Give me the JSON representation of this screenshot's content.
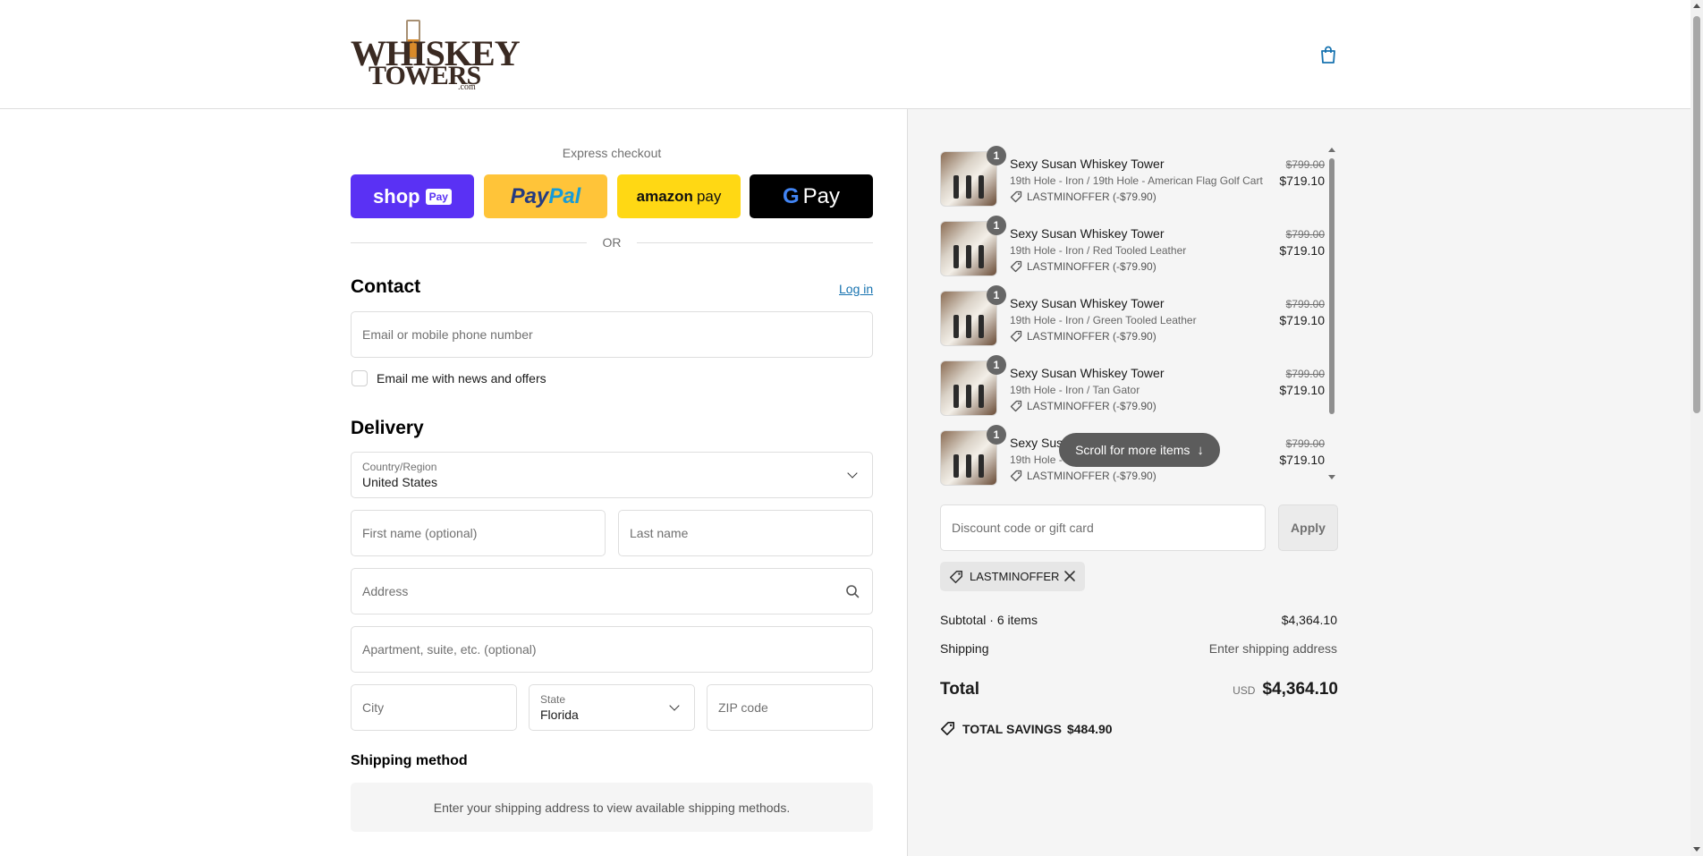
{
  "header": {
    "logo_top": "WHISKEY",
    "logo_bottom": "TOWERS",
    "logo_com": ".com",
    "cart_icon": "shopping-bag-icon"
  },
  "express": {
    "title": "Express checkout",
    "shop_label": "shop",
    "shop_tag": "Pay",
    "paypal_a": "Pay",
    "paypal_b": "Pal",
    "amazon_a": "amazon",
    "amazon_b": "pay",
    "gpay_g": "G",
    "gpay_label": "Pay",
    "or": "OR"
  },
  "contact": {
    "title": "Contact",
    "login": "Log in",
    "email_placeholder": "Email or mobile phone number",
    "newsletter": "Email me with news and offers"
  },
  "delivery": {
    "title": "Delivery",
    "country_label": "Country/Region",
    "country_value": "United States",
    "first_name": "First name (optional)",
    "last_name": "Last name",
    "address": "Address",
    "apartment": "Apartment, suite, etc. (optional)",
    "city": "City",
    "state_label": "State",
    "state_value": "Florida",
    "zip": "ZIP code"
  },
  "shipping_method": {
    "title": "Shipping method",
    "message": "Enter your shipping address to view available shipping methods."
  },
  "cart": {
    "items": [
      {
        "qty": "1",
        "name": "Sexy Susan Whiskey Tower",
        "variant": "19th Hole - Iron / 19th Hole - American Flag Golf Cart",
        "discount": "LASTMINOFFER (-$79.90)",
        "old_price": "$799.00",
        "price": "$719.10"
      },
      {
        "qty": "1",
        "name": "Sexy Susan Whiskey Tower",
        "variant": "19th Hole - Iron / Red Tooled Leather",
        "discount": "LASTMINOFFER (-$79.90)",
        "old_price": "$799.00",
        "price": "$719.10"
      },
      {
        "qty": "1",
        "name": "Sexy Susan Whiskey Tower",
        "variant": "19th Hole - Iron / Green Tooled Leather",
        "discount": "LASTMINOFFER (-$79.90)",
        "old_price": "$799.00",
        "price": "$719.10"
      },
      {
        "qty": "1",
        "name": "Sexy Susan Whiskey Tower",
        "variant": "19th Hole - Iron / Tan Gator",
        "discount": "LASTMINOFFER (-$79.90)",
        "old_price": "$799.00",
        "price": "$719.10"
      },
      {
        "qty": "1",
        "name": "Sexy Susa",
        "variant": "19th Hole -",
        "discount": "LASTMINOFFER (-$79.90)",
        "old_price": "$799.00",
        "price": "$719.10"
      }
    ],
    "scroll_hint": "Scroll for more items",
    "discount_placeholder": "Discount code or gift card",
    "apply": "Apply",
    "applied_code": "LASTMINOFFER",
    "subtotal_label": "Subtotal · 6 items",
    "subtotal_value": "$4,364.10",
    "shipping_label": "Shipping",
    "shipping_value": "Enter shipping address",
    "total_label": "Total",
    "currency": "USD",
    "total_value": "$4,364.10",
    "savings_label": "TOTAL SAVINGS",
    "savings_value": "$484.90"
  },
  "colors": {
    "shop_pay": "#5a31f4",
    "paypal": "#ffc439",
    "amazon_pay": "#ffd814",
    "google_pay": "#000000",
    "link": "#1773b0"
  }
}
